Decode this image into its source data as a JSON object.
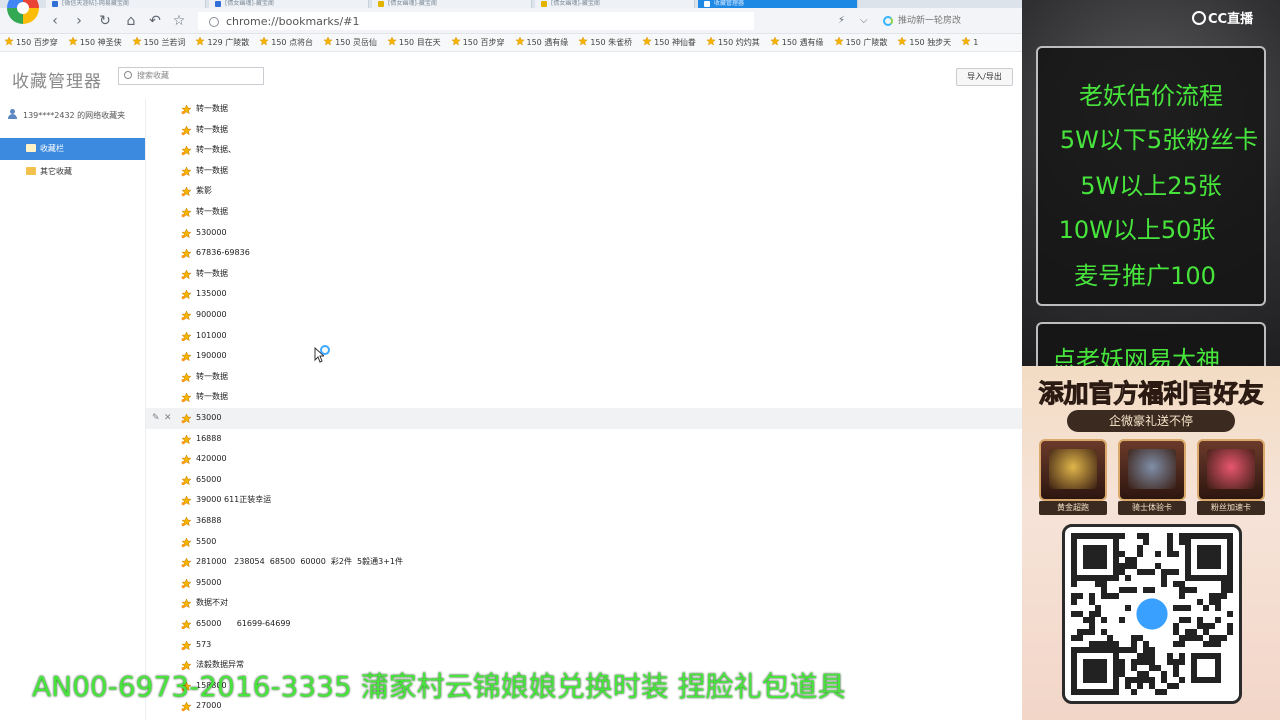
{
  "browser": {
    "tabs": [
      {
        "label": "[微信天涯帖]-网易藏宝阁",
        "active": false,
        "color": "#2f6fd6"
      },
      {
        "label": "[倩女幽魂]-藏宝阁",
        "active": false,
        "color": "#2f6fd6"
      },
      {
        "label": "[倩女幽魂]-藏宝阁",
        "active": false,
        "color": "#e2b400"
      },
      {
        "label": "[倩女幽魂]-藏宝阁",
        "active": false,
        "color": "#e2b400"
      },
      {
        "label": "收藏管理器",
        "active": true,
        "color": "#ffffff"
      }
    ],
    "nav": {
      "back": "‹",
      "forward": "›",
      "reload": "↻",
      "home": "⌂",
      "undo": "↶",
      "star": "☆"
    },
    "address": "chrome://bookmarks/#1",
    "address_host": "bookmarks",
    "toolbar_right": {
      "bolt": "⚡",
      "chevron": "⌵"
    },
    "search_text": "推动新一轮房改"
  },
  "bookmarks_bar": [
    "150 百步穿",
    "150 神圣侠",
    "150 兰若词",
    "129 广陵散",
    "150 点将台",
    "150 灵岳仙",
    "150 目在天",
    "150 百步穿",
    "150 遇有缘",
    "150 朱雀桥",
    "150 神仙眷",
    "150 灼灼其",
    "150 遇有缘",
    "150 广陵散",
    "150 独步天",
    "1"
  ],
  "manager": {
    "title": "收藏管理器",
    "search_placeholder": "搜索收藏",
    "import_export": "导入/导出",
    "account": "139****2432 的网络收藏夹",
    "folders": [
      {
        "label": "收藏栏",
        "selected": true
      },
      {
        "label": "其它收藏",
        "selected": false
      }
    ],
    "edit_icon": "✎",
    "delete_icon": "✕",
    "items": [
      "转一数据",
      "转一数据",
      "转一数据、",
      "转一数据",
      "紫影",
      "转一数据",
      "530000",
      "67836-69836",
      "转一数据",
      "135000",
      "900000",
      "101000",
      "190000",
      "转一数据",
      "转一数据",
      "53000",
      "16888",
      "420000",
      "65000",
      "39000 611正装幸运",
      "36888",
      "5500",
      "281000   238054  68500  60000  彩2件  5毅通3+1件",
      "95000",
      "数据不对",
      "65000      61699-64699",
      "573",
      "法毅数据异常",
      "158800",
      "27000"
    ],
    "hover_index": 15
  },
  "overlay": {
    "brand": "CC直播",
    "lines": [
      "老妖估价流程",
      "5W以下5张粉丝卡",
      "5W以上25张",
      "10W以上50张",
      "麦号推广100"
    ],
    "tail_line": "点老妖网易大神",
    "promo_title": "添加官方福利官好友",
    "promo_subtitle": "企微豪礼送不停",
    "cards": [
      {
        "label": "黄金超跑",
        "color": "#e0b64a"
      },
      {
        "label": "骑士体验卡",
        "color": "#7f8fa8"
      },
      {
        "label": "粉丝加速卡",
        "color": "#e8566e"
      }
    ]
  },
  "caption": "AN00-6973-2016-3335 蒲家村云锦娘娘兑换时装 捏脸礼包道具"
}
